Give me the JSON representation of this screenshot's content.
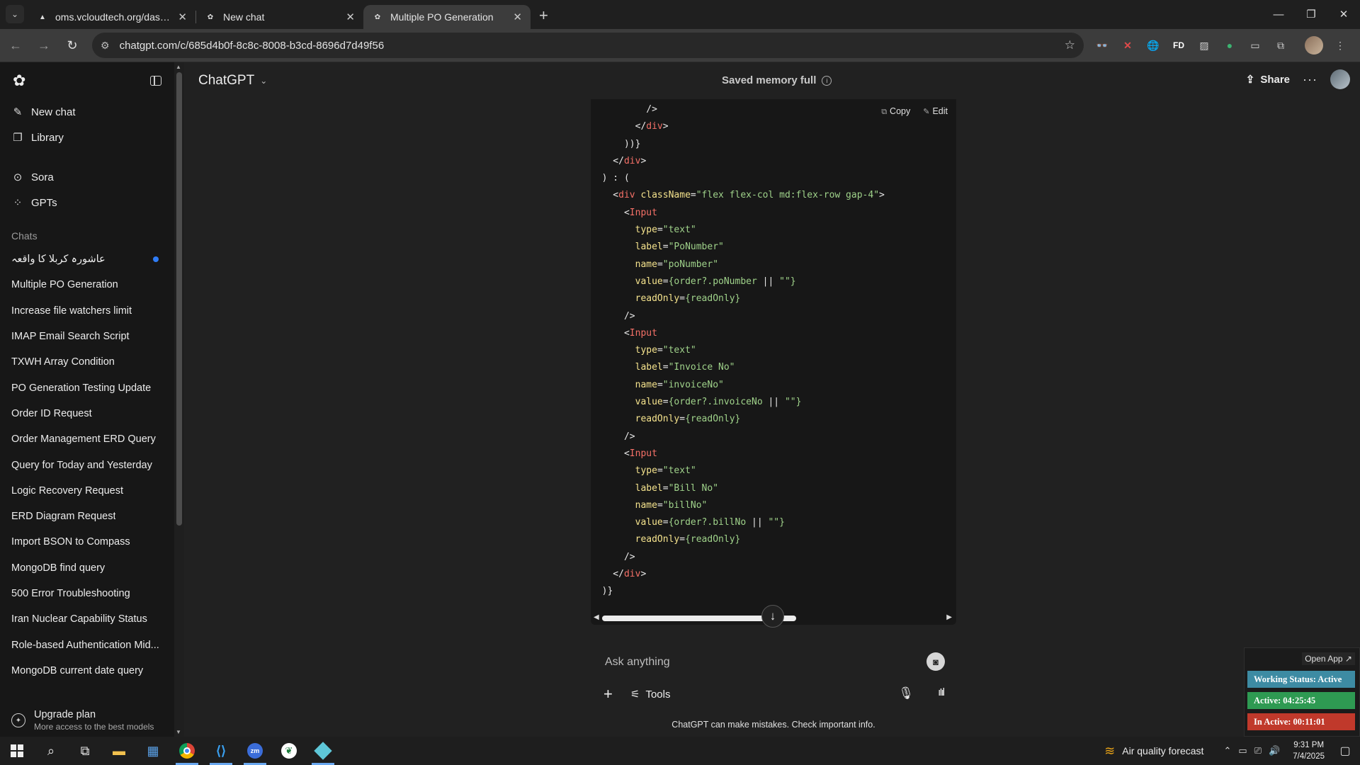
{
  "browser": {
    "tabs": [
      {
        "title": "oms.vcloudtech.org/dashboard",
        "active": false
      },
      {
        "title": "New chat",
        "active": false
      },
      {
        "title": "Multiple PO Generation",
        "active": true
      }
    ],
    "url": "chatgpt.com/c/685d4b0f-8c8c-8008-b3cd-8696d7d49f56",
    "extensions": [
      "glasses-icon",
      "x-icon",
      "globe-icon",
      "FD",
      "image-icon",
      "green-circle-icon",
      "cast-icon",
      "puzzle-icon"
    ]
  },
  "sidebar": {
    "items": [
      {
        "label": "New chat",
        "icon": "compose-icon"
      },
      {
        "label": "Library",
        "icon": "library-icon"
      },
      {
        "label": "Sora",
        "icon": "play-circle-icon"
      },
      {
        "label": "GPTs",
        "icon": "grid-icon"
      }
    ],
    "chats_heading": "Chats",
    "chats": [
      "عاشورہ کربلا کا واقعہ",
      "Multiple PO Generation",
      "Increase file watchers limit",
      "IMAP Email Search Script",
      "TXWH Array Condition",
      "PO Generation Testing Update",
      "Order ID Request",
      "Order Management ERD Query",
      "Query for Today and Yesterday",
      "Logic Recovery Request",
      "ERD Diagram Request",
      "Import BSON to Compass",
      "MongoDB find query",
      "500 Error Troubleshooting",
      "Iran Nuclear Capability Status",
      "Role-based Authentication Mid...",
      "MongoDB current date query"
    ],
    "upgrade_title": "Upgrade plan",
    "upgrade_sub": "More access to the best models"
  },
  "header": {
    "model": "ChatGPT",
    "memory": "Saved memory full",
    "share": "Share"
  },
  "code": {
    "copy": "Copy",
    "edit": "Edit",
    "lines": [
      [
        [
          "p",
          "          />"
        ]
      ],
      [
        [
          "p",
          "        </"
        ],
        [
          "tag",
          "div"
        ],
        [
          "p",
          ">"
        ]
      ],
      [
        [
          "p",
          "      ))}"
        ]
      ],
      [
        [
          "p",
          "    </"
        ],
        [
          "tag",
          "div"
        ],
        [
          "p",
          ">"
        ]
      ],
      [
        [
          "p",
          "  ) : ("
        ]
      ],
      [
        [
          "p",
          "    <"
        ],
        [
          "tag",
          "div"
        ],
        [
          "p",
          " "
        ],
        [
          "attr",
          "className"
        ],
        [
          "p",
          "="
        ],
        [
          "str",
          "\"flex flex-col md:flex-row gap-4\""
        ],
        [
          "p",
          ">"
        ]
      ],
      [
        [
          "p",
          "      <"
        ],
        [
          "tag",
          "Input"
        ]
      ],
      [
        [
          "p",
          "        "
        ],
        [
          "attr",
          "type"
        ],
        [
          "p",
          "="
        ],
        [
          "str",
          "\"text\""
        ]
      ],
      [
        [
          "p",
          "        "
        ],
        [
          "attr",
          "label"
        ],
        [
          "p",
          "="
        ],
        [
          "str",
          "\"PoNumber\""
        ]
      ],
      [
        [
          "p",
          "        "
        ],
        [
          "attr",
          "name"
        ],
        [
          "p",
          "="
        ],
        [
          "str",
          "\"poNumber\""
        ]
      ],
      [
        [
          "p",
          "        "
        ],
        [
          "attr",
          "value"
        ],
        [
          "p",
          "="
        ],
        [
          "str",
          "{order?.poNumber"
        ],
        [
          "p",
          " || "
        ],
        [
          "str",
          "\"\"}"
        ]
      ],
      [
        [
          "p",
          "        "
        ],
        [
          "attr",
          "readOnly"
        ],
        [
          "p",
          "="
        ],
        [
          "str",
          "{readOnly}"
        ]
      ],
      [
        [
          "p",
          "      />"
        ]
      ],
      [
        [
          "p",
          "      <"
        ],
        [
          "tag",
          "Input"
        ]
      ],
      [
        [
          "p",
          "        "
        ],
        [
          "attr",
          "type"
        ],
        [
          "p",
          "="
        ],
        [
          "str",
          "\"text\""
        ]
      ],
      [
        [
          "p",
          "        "
        ],
        [
          "attr",
          "label"
        ],
        [
          "p",
          "="
        ],
        [
          "str",
          "\"Invoice No\""
        ]
      ],
      [
        [
          "p",
          "        "
        ],
        [
          "attr",
          "name"
        ],
        [
          "p",
          "="
        ],
        [
          "str",
          "\"invoiceNo\""
        ]
      ],
      [
        [
          "p",
          "        "
        ],
        [
          "attr",
          "value"
        ],
        [
          "p",
          "="
        ],
        [
          "str",
          "{order?.invoiceNo"
        ],
        [
          "p",
          " || "
        ],
        [
          "str",
          "\"\"}"
        ]
      ],
      [
        [
          "p",
          "        "
        ],
        [
          "attr",
          "readOnly"
        ],
        [
          "p",
          "="
        ],
        [
          "str",
          "{readOnly}"
        ]
      ],
      [
        [
          "p",
          "      />"
        ]
      ],
      [
        [
          "p",
          "      <"
        ],
        [
          "tag",
          "Input"
        ]
      ],
      [
        [
          "p",
          "        "
        ],
        [
          "attr",
          "type"
        ],
        [
          "p",
          "="
        ],
        [
          "str",
          "\"text\""
        ]
      ],
      [
        [
          "p",
          "        "
        ],
        [
          "attr",
          "label"
        ],
        [
          "p",
          "="
        ],
        [
          "str",
          "\"Bill No\""
        ]
      ],
      [
        [
          "p",
          "        "
        ],
        [
          "attr",
          "name"
        ],
        [
          "p",
          "="
        ],
        [
          "str",
          "\"billNo\""
        ]
      ],
      [
        [
          "p",
          "        "
        ],
        [
          "attr",
          "value"
        ],
        [
          "p",
          "="
        ],
        [
          "str",
          "{order?.billNo"
        ],
        [
          "p",
          " || "
        ],
        [
          "str",
          "\"\"}"
        ]
      ],
      [
        [
          "p",
          "        "
        ],
        [
          "attr",
          "readOnly"
        ],
        [
          "p",
          "="
        ],
        [
          "str",
          "{readOnly}"
        ]
      ],
      [
        [
          "p",
          "      />"
        ]
      ],
      [
        [
          "p",
          "    </"
        ],
        [
          "tag",
          "div"
        ],
        [
          "p",
          ">"
        ]
      ],
      [
        [
          "p",
          "  )}"
        ]
      ]
    ]
  },
  "composer": {
    "placeholder": "Ask anything",
    "tools": "Tools",
    "disclaimer": "ChatGPT can make mistakes. Check important info."
  },
  "status_widget": {
    "open_app": "Open App ↗",
    "working": "Working Status: Active",
    "active": "Active: 04:25:45",
    "inactive": "In Active: 00:11:01",
    "colors": {
      "working": "#3d8ba3",
      "active": "#2e9a52",
      "inactive": "#c0392b"
    }
  },
  "taskbar": {
    "weather": "Air quality forecast",
    "time": "9:31 PM",
    "date": "7/4/2025"
  }
}
